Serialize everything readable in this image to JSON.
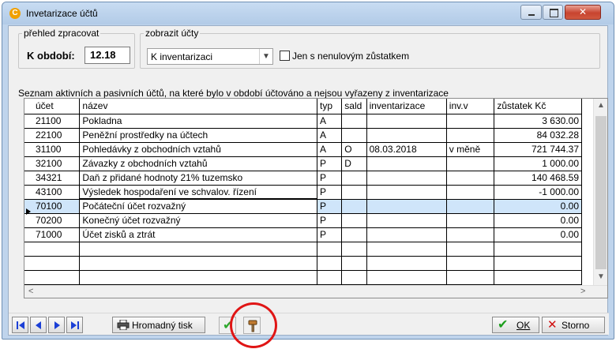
{
  "window": {
    "title": "Invetarizace účtů",
    "icon_letter": "C"
  },
  "prehled": {
    "legend": "přehled zpracovat",
    "obdobi_label": "K období:",
    "obdobi_value": "12.18"
  },
  "zobrazit": {
    "legend": "zobrazit účty",
    "combo_value": "K inventarizaci",
    "checkbox_label": "Jen s nenulovým zůstatkem",
    "checkbox_checked": false
  },
  "list_label": "Seznam aktivních a pasivních účtů, na které bylo v období účtováno a nejsou vyřazeny z inventarizace",
  "columns": [
    "účet",
    "název",
    "typ",
    "sald",
    "inventarizace",
    "inv.v",
    "zůstatek Kč"
  ],
  "rows": [
    {
      "ucet": "21100",
      "nazev": "Pokladna",
      "typ": "A",
      "sald": "",
      "inventarizace": "",
      "invv": "",
      "zustatek": "3 630.00"
    },
    {
      "ucet": "22100",
      "nazev": "Peněžní prostředky na účtech",
      "typ": "A",
      "sald": "",
      "inventarizace": "",
      "invv": "",
      "zustatek": "84 032.28"
    },
    {
      "ucet": "31100",
      "nazev": "Pohledávky z obchodních vztahů",
      "typ": "A",
      "sald": "O",
      "inventarizace": "08.03.2018",
      "invv": "v měně",
      "zustatek": "721 744.37"
    },
    {
      "ucet": "32100",
      "nazev": "Závazky z obchodních vztahů",
      "typ": "P",
      "sald": "D",
      "inventarizace": "",
      "invv": "",
      "zustatek": "1 000.00"
    },
    {
      "ucet": "34321",
      "nazev": "Daň z přidané hodnoty 21% tuzemsko",
      "typ": "P",
      "sald": "",
      "inventarizace": "",
      "invv": "",
      "zustatek": "140 468.59"
    },
    {
      "ucet": "43100",
      "nazev": "Výsledek hospodaření ve schvalov. řízení",
      "typ": "P",
      "sald": "",
      "inventarizace": "",
      "invv": "",
      "zustatek": "-1 000.00"
    },
    {
      "ucet": "70100",
      "nazev": "Počáteční účet rozvažný",
      "typ": "P",
      "sald": "",
      "inventarizace": "",
      "invv": "",
      "zustatek": "0.00"
    },
    {
      "ucet": "70200",
      "nazev": "Konečný účet rozvažný",
      "typ": "P",
      "sald": "",
      "inventarizace": "",
      "invv": "",
      "zustatek": "0.00"
    },
    {
      "ucet": "71000",
      "nazev": "Účet zisků a ztrát",
      "typ": "P",
      "sald": "",
      "inventarizace": "",
      "invv": "",
      "zustatek": "0.00"
    }
  ],
  "selected_row_index": 6,
  "toolbar": {
    "hromadny_label": "Hromadný tisk",
    "ok_label": "OK",
    "storno_label": "Storno"
  },
  "colors": {
    "selection": "#cfe5fa",
    "nav_blue": "#1b3fd6",
    "annotation_red": "#e01515",
    "titlebar": "#bfd4ec"
  }
}
